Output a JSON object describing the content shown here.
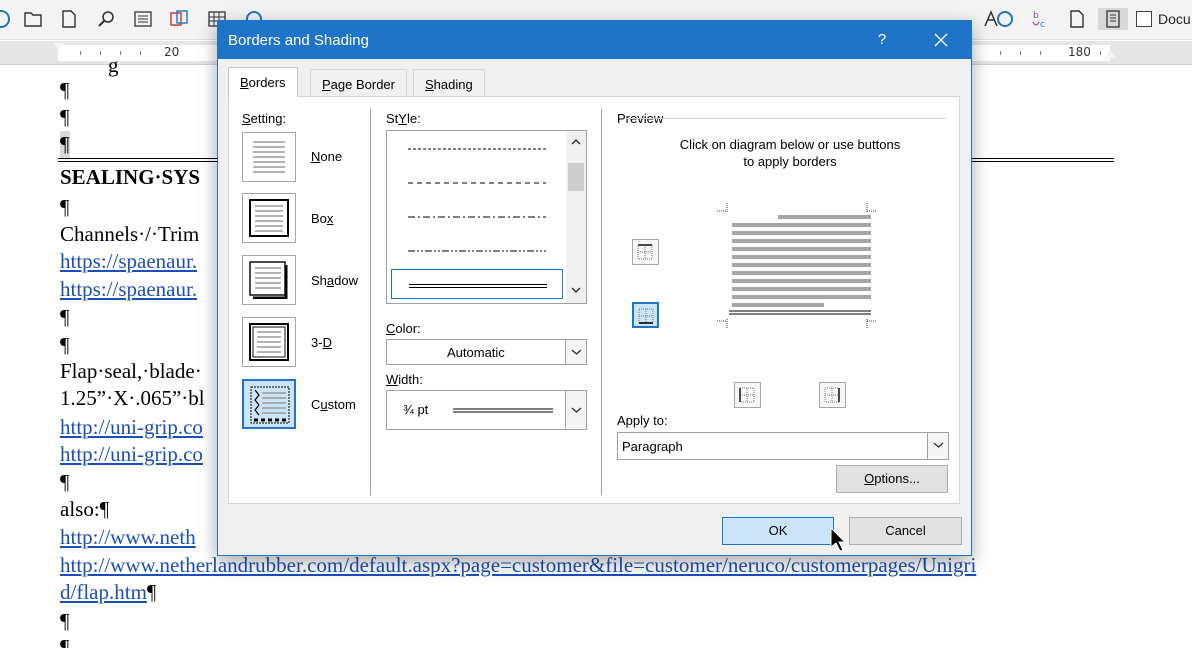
{
  "document": {
    "option_label": "Docu",
    "ruler_numbers": [
      "20",
      "180"
    ],
    "lines": [
      "g",
      "¶",
      "¶",
      "¶",
      "SEALING·SYS",
      "¶",
      "Channels·/·Trim",
      "https://spaenaur.",
      "https://spaenaur.",
      "¶",
      "¶",
      "Flap·seal,·blade·",
      "1.25”·X·.065”·bl",
      "http://uni-grip.co",
      "http://uni-grip.co",
      "¶",
      "also:¶",
      "http://www.neth",
      "http://www.netherlandrubber.com/default.aspx?page=customer&file=customer/neruco/customerpages/Unigri",
      "d/flap.htm",
      "¶",
      "¶",
      "¶"
    ]
  },
  "dialog": {
    "title": "Borders and Shading",
    "help": "?",
    "tabs": [
      {
        "pre": "",
        "u": "B",
        "post": "orders"
      },
      {
        "pre": "",
        "u": "P",
        "post": "age Border"
      },
      {
        "pre": "",
        "u": "S",
        "post": "hading"
      }
    ],
    "setting_label": {
      "u": "S",
      "post": "etting:"
    },
    "settings": [
      {
        "pre": "",
        "u": "N",
        "post": "one"
      },
      {
        "pre": "Bo",
        "u": "x",
        "post": ""
      },
      {
        "pre": "Sh",
        "u": "a",
        "post": "dow"
      },
      {
        "pre": "3-",
        "u": "D",
        "post": ""
      },
      {
        "pre": "C",
        "u": "u",
        "post": "stom"
      }
    ],
    "style_label": {
      "u": "Y",
      "pre": "St",
      "post": "le:"
    },
    "color_label": {
      "pre": "",
      "u": "C",
      "post": "olor:"
    },
    "color_value": "Automatic",
    "width_label": {
      "pre": "",
      "u": "W",
      "post": "idth:"
    },
    "width_value": "¾ pt",
    "preview_title": "Preview",
    "preview_hint_1": "Click on diagram below or use buttons",
    "preview_hint_2": "to apply borders",
    "apply_label": {
      "pre": "Apply to:",
      "u": "",
      "post": ""
    },
    "apply_value": "Paragraph",
    "options_button": {
      "pre": "",
      "u": "O",
      "post": "ptions..."
    },
    "ok_button": "OK",
    "cancel_button": "Cancel",
    "accent_color": "#1f73c8"
  }
}
